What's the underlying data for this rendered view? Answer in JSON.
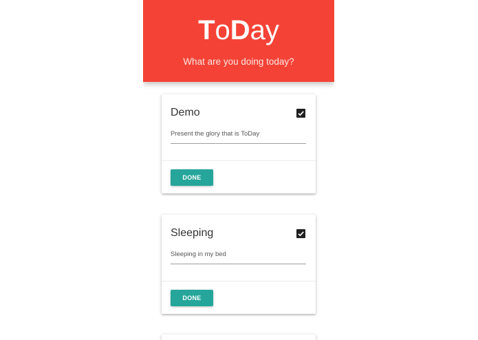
{
  "header": {
    "logo_parts": [
      "T",
      "o",
      "D",
      "ay"
    ],
    "tagline": "What are you doing today?",
    "background": "#f44336"
  },
  "tasks": [
    {
      "title": "Demo",
      "description": "Present the glory that is ToDay",
      "checked": true,
      "done_label": "DONE"
    },
    {
      "title": "Sleeping",
      "description": "Sleeping in my bed",
      "checked": true,
      "done_label": "DONE"
    }
  ],
  "colors": {
    "accent": "#26a69a",
    "checkbox": "#212121"
  },
  "icons": {
    "checkbox": "checkbox-checked-icon"
  }
}
